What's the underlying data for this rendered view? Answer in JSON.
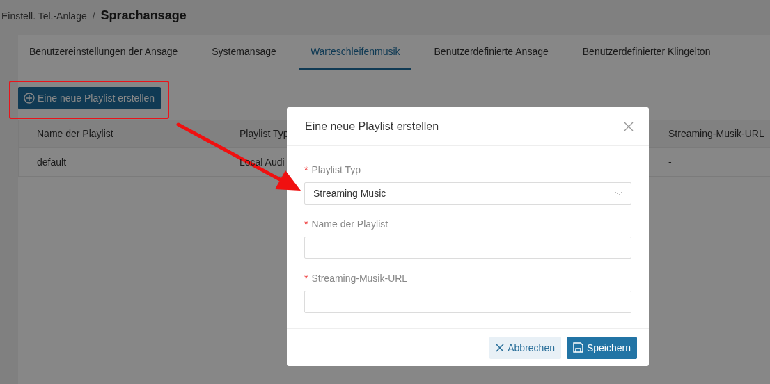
{
  "breadcrumb": {
    "parent": "Einstell. Tel.-Anlage",
    "separator": "/",
    "current": "Sprachansage"
  },
  "tabs": [
    {
      "label": "Benutzereinstellungen der Ansage",
      "selected": false
    },
    {
      "label": "Systemansage",
      "selected": false
    },
    {
      "label": "Warteschleifenmusik",
      "selected": true
    },
    {
      "label": "Benutzerdefinierte Ansage",
      "selected": false
    },
    {
      "label": "Benutzerdefinierter Klingelton",
      "selected": false
    }
  ],
  "create_button": {
    "label": "Eine neue Playlist erstellen"
  },
  "table": {
    "columns": [
      "Name der Playlist",
      "Playlist Typ",
      "Streaming-Musik-URL"
    ],
    "rows": [
      [
        "default",
        "Local Audi",
        "-"
      ]
    ]
  },
  "dialog": {
    "title": "Eine neue Playlist erstellen",
    "required_mark": "*",
    "fields": [
      {
        "kind": "select",
        "label": "Playlist Typ",
        "required": true,
        "value": "Streaming Music"
      },
      {
        "kind": "text",
        "label": "Name der Playlist",
        "required": true
      },
      {
        "kind": "text",
        "label": "Streaming-Musik-URL",
        "required": true
      }
    ],
    "buttons": [
      {
        "kind": "cancel",
        "label": "Abbrechen"
      },
      {
        "kind": "save",
        "label": "Speichern"
      }
    ]
  }
}
